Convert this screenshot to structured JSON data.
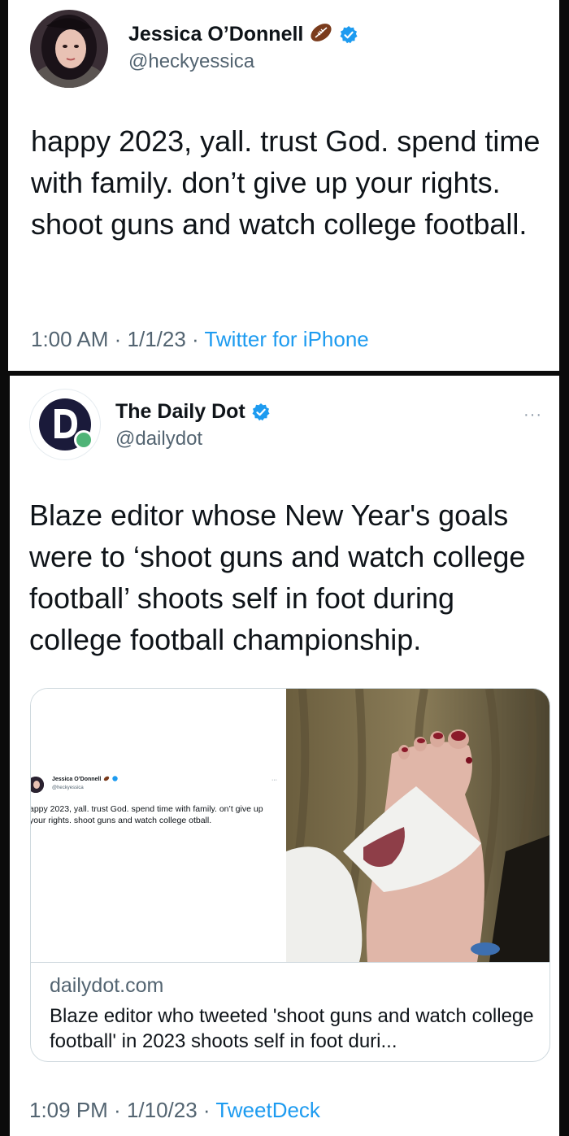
{
  "tweet1": {
    "display_name": "Jessica O’Donnell",
    "handle": "@heckyessica",
    "text": "happy 2023, yall. trust God. spend time with family. don’t give up your rights. shoot guns and watch college football.",
    "time": "1:00 AM",
    "date": "1/1/23",
    "source": "Twitter for iPhone",
    "sep": " · "
  },
  "tweet2": {
    "display_name": "The Daily Dot",
    "handle": "@dailydot",
    "more": "···",
    "text": "Blaze editor whose New Year's goals were to ‘shoot guns and watch college football’ shoots self in foot during college football championship.",
    "time": "1:09 PM",
    "date": "1/10/23",
    "source": "TweetDeck",
    "sep": " · ",
    "card": {
      "domain": "dailydot.com",
      "title": "Blaze editor who tweeted 'shoot guns and watch college football' in 2023 shoots self in foot duri...",
      "thumb": {
        "display_name": "Jessica O’Donnell",
        "handle": "@heckyessica",
        "more": "···",
        "text": "appy 2023, yall. trust God. spend time with family. on’t give up your rights. shoot guns and watch college otball."
      }
    }
  },
  "colors": {
    "verified": "#1d9bf0",
    "link": "#1d9bf0",
    "secondary_text": "#536471",
    "dailydot_dot": "#4fb477",
    "dailydot_navy": "#1a1a3a"
  },
  "icons": [
    "football-icon",
    "verified-badge-icon",
    "more-options-icon",
    "dailydot-logo"
  ]
}
